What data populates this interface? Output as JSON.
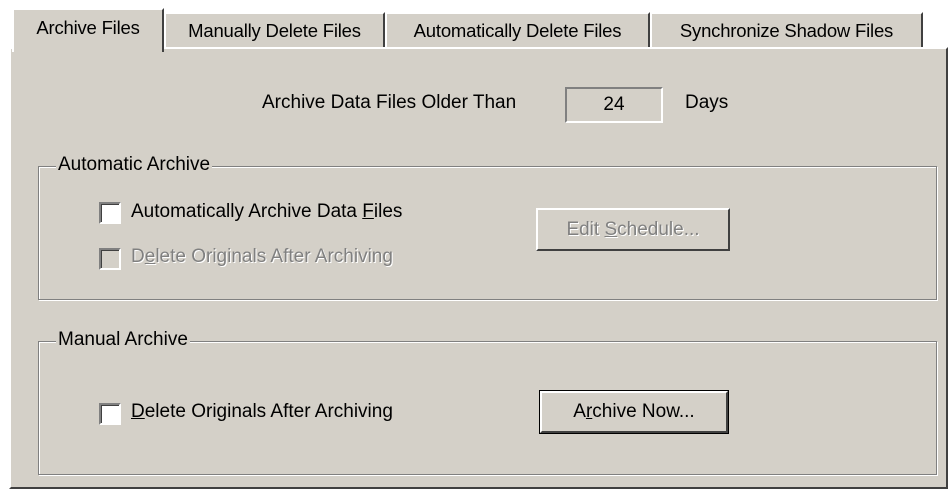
{
  "tabs": [
    {
      "label": "Archive Files",
      "active": true
    },
    {
      "label": "Manually Delete Files",
      "active": false
    },
    {
      "label": "Automatically Delete Files",
      "active": false
    },
    {
      "label": "Synchronize Shadow Files",
      "active": false
    }
  ],
  "archive_age": {
    "label": "Archive Data Files Older Than",
    "value": "24",
    "unit": "Days"
  },
  "automatic_archive": {
    "title": "Automatic Archive",
    "auto_archive_checkbox": {
      "pre": "Automatically Archive Data ",
      "mnemonic": "F",
      "post": "iles",
      "checked": false,
      "enabled": true
    },
    "delete_originals_checkbox": {
      "pre": "D",
      "mnemonic": "e",
      "post": "lete Originals After Archiving",
      "checked": false,
      "enabled": false
    },
    "edit_schedule_button": {
      "pre": "Edit ",
      "mnemonic": "S",
      "post": "chedule...",
      "enabled": false
    }
  },
  "manual_archive": {
    "title": "Manual Archive",
    "delete_originals_checkbox": {
      "pre": "",
      "mnemonic": "D",
      "post": "elete Originals After Archiving",
      "checked": false,
      "enabled": true
    },
    "archive_now_button": {
      "pre": "A",
      "mnemonic": "r",
      "post": "chive Now...",
      "enabled": true
    }
  },
  "colors": {
    "face": "#d4d0c8",
    "highlight": "#ffffff",
    "shadow": "#808080",
    "dark_shadow": "#404040",
    "disabled_text": "#808080"
  }
}
